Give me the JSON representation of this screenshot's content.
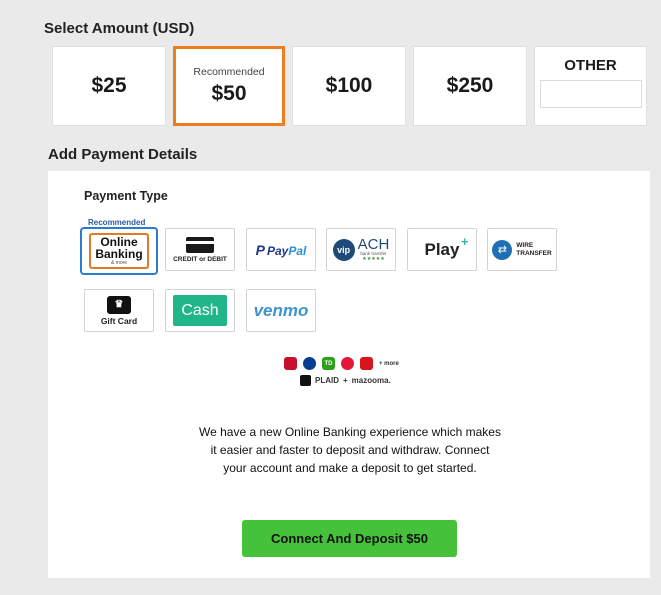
{
  "select_amount": {
    "title": "Select Amount (USD)",
    "options": [
      {
        "label": "$25",
        "recommended": false,
        "selected": false
      },
      {
        "label": "$50",
        "recommended": true,
        "recommended_label": "Recommended",
        "selected": true
      },
      {
        "label": "$100",
        "recommended": false,
        "selected": false
      },
      {
        "label": "$250",
        "recommended": false,
        "selected": false
      }
    ],
    "other_label": "OTHER",
    "other_value": ""
  },
  "payment_details": {
    "title": "Add Payment Details",
    "payment_type_label": "Payment Type",
    "recommended_tag": "Recommended",
    "methods": {
      "online_banking": {
        "line1": "Online",
        "line2": "Banking",
        "sub": "& more",
        "selected": true
      },
      "card": {
        "text": "CREDIT or DEBIT"
      },
      "paypal": {
        "p": "P",
        "pay": "Pay",
        "pal": "Pal"
      },
      "vip_ach": {
        "vip": "vip",
        "ach": "ACH",
        "sub": "bank transfer",
        "stars": "★★★★★"
      },
      "play_plus": {
        "text": "Play",
        "plus": "+"
      },
      "wire": {
        "line1": "WIRE",
        "line2": "TRANSFER"
      },
      "gift_card": {
        "text": "Gift Card"
      },
      "cash": {
        "text": "Cash"
      },
      "venmo": {
        "text": "venmo"
      }
    },
    "partner_logos": {
      "more": "+ more",
      "plaid": "PLAID",
      "plus": "+",
      "mazooma": "mazooma."
    },
    "info_text": "We have a new Online Banking experience which makes it easier and faster to deposit and withdraw. Connect your account and make a deposit to get started.",
    "cta_button": "Connect And Deposit $50"
  },
  "colors": {
    "selected_amount_border": "#ee7d1f",
    "selected_method_border": "#2b7bd0",
    "cta_background": "#46c23a",
    "cash_background": "#20b68a",
    "venmo": "#3d95ce"
  }
}
